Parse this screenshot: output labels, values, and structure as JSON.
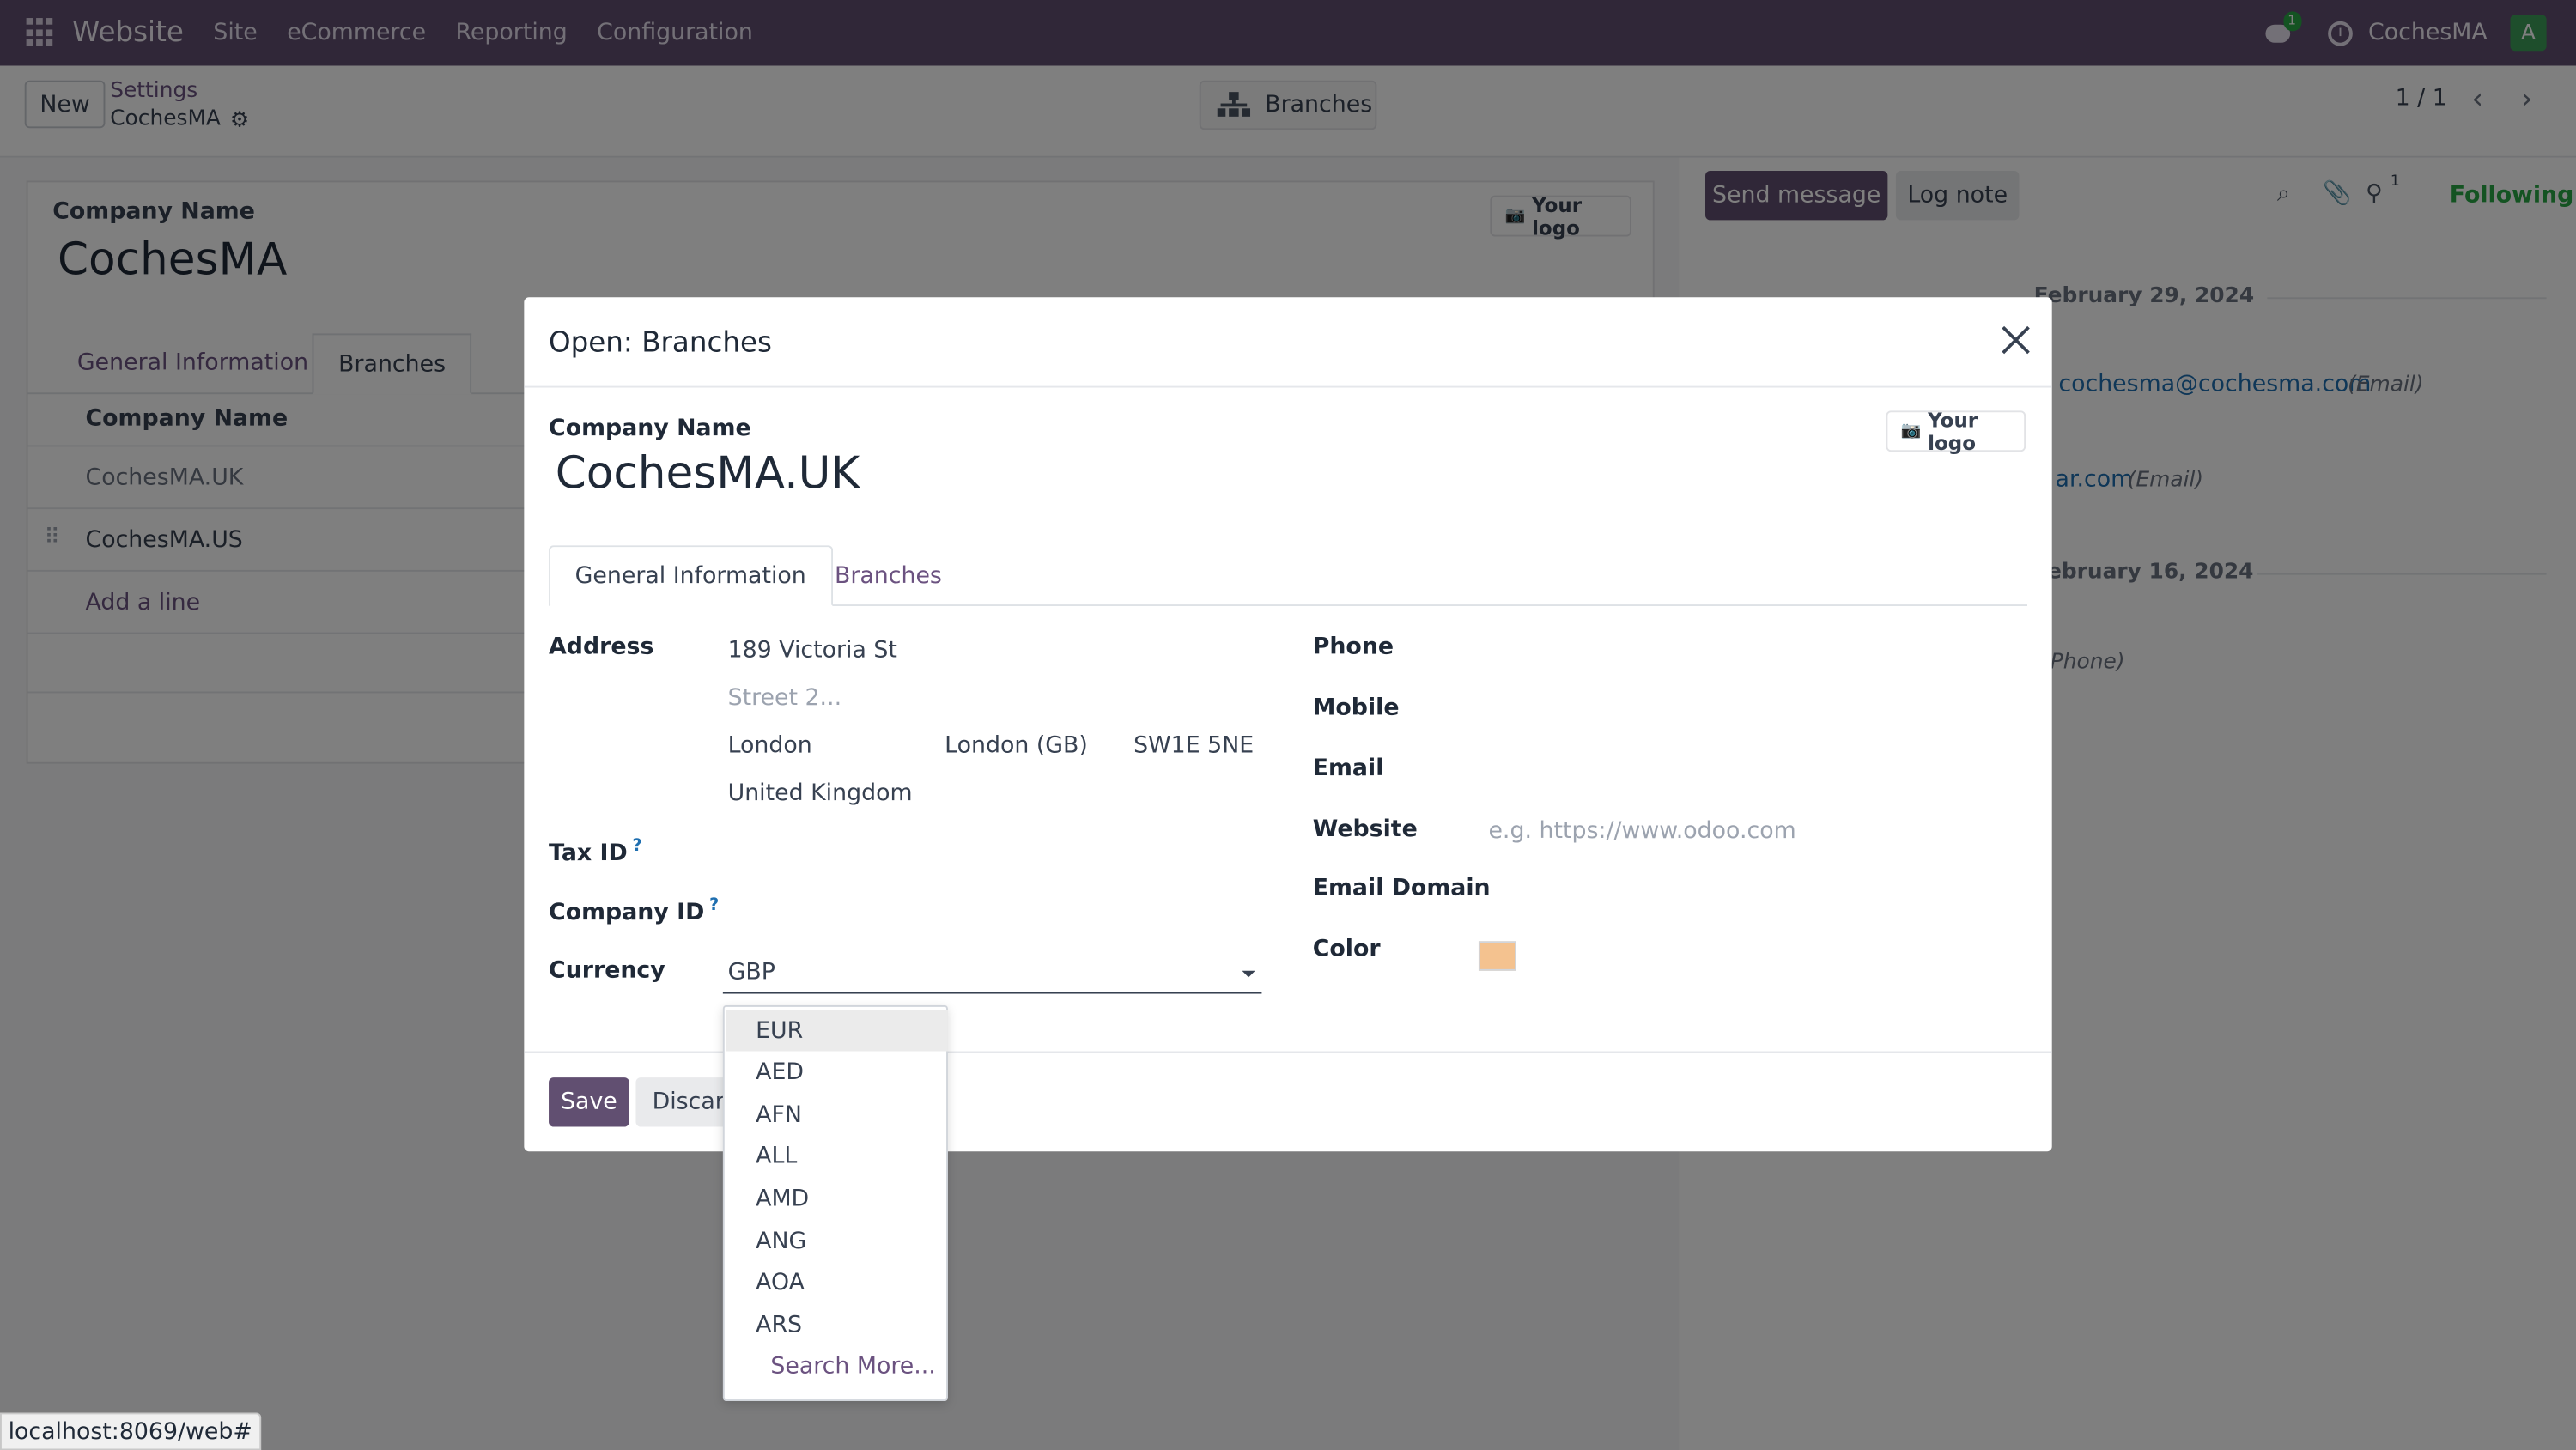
{
  "navbar": {
    "brand": "Website",
    "menu": [
      "Site",
      "eCommerce",
      "Reporting",
      "Configuration"
    ],
    "chat_badge": "1",
    "company": "CochesMA",
    "avatar_letter": "A"
  },
  "control_panel": {
    "new_label": "New",
    "breadcrumb_parent": "Settings",
    "breadcrumb_current": "CochesMA",
    "branches_button": "Branches",
    "pager": "1 / 1"
  },
  "background_form": {
    "company_name_label": "Company Name",
    "company_name": "CochesMA",
    "your_logo": "Your logo",
    "tabs": [
      "General Information",
      "Branches"
    ],
    "list_header": "Company Name",
    "rows": [
      "CochesMA.UK",
      "CochesMA.US"
    ],
    "add_line": "Add a line"
  },
  "chatter": {
    "send_message": "Send message",
    "log_note": "Log note",
    "followers_count": "1",
    "following": "Following",
    "date1": "February 29, 2024",
    "email1": "cochesma@cochesma.com",
    "email1_note": "(Email)",
    "email2": "ar.com",
    "email2_note": "(Email)",
    "date2": "ebruary 16, 2024",
    "phone_note": "Phone)"
  },
  "modal": {
    "title": "Open: Branches",
    "company_name_label": "Company Name",
    "company_name": "CochesMA.UK",
    "your_logo": "Your logo",
    "tabs": [
      "General Information",
      "Branches"
    ],
    "address_label": "Address",
    "street": "189 Victoria St",
    "street2_placeholder": "Street 2...",
    "city": "London",
    "state": "London (GB)",
    "zip": "SW1E 5NE",
    "country": "United Kingdom",
    "tax_id_label": "Tax ID",
    "company_id_label": "Company ID",
    "help_mark": "?",
    "currency_label": "Currency",
    "currency_value": "GBP",
    "phone_label": "Phone",
    "mobile_label": "Mobile",
    "email_label": "Email",
    "website_label": "Website",
    "website_placeholder": "e.g. https://www.odoo.com",
    "email_domain_label": "Email Domain",
    "color_label": "Color",
    "color_value": "#f4c28f",
    "save": "Save",
    "discard": "Discard"
  },
  "dropdown": {
    "options": [
      "EUR",
      "AED",
      "AFN",
      "ALL",
      "AMD",
      "ANG",
      "AOA",
      "ARS"
    ],
    "highlighted": "EUR",
    "search_more": "Search More..."
  },
  "status_bar": "localhost:8069/web#",
  "colors": {
    "brand": "#614f71",
    "accent_link": "#6b5280",
    "following": "#28a745"
  }
}
